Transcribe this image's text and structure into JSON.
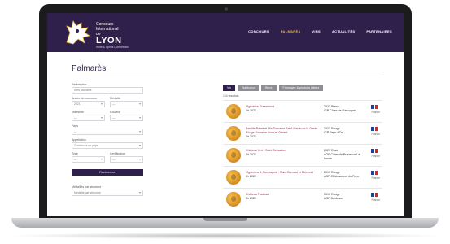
{
  "brand": {
    "line1": "Concours",
    "line2": "International",
    "line3": "de",
    "name": "LYON",
    "tagline": "Wine & Spirits Competition"
  },
  "nav": [
    "CONCOURS",
    "PALMARÈS",
    "VINS",
    "ACTUALITÉS",
    "PARTENAIRES"
  ],
  "page_title": "Palmarès",
  "filters": {
    "search_label": "Rechercher",
    "search_placeholder": "nom, domaine",
    "year_label": "Année du concours",
    "year_value": "2021",
    "medal_label": "Médaille",
    "medal_value": "—",
    "vintage_label": "Millésime",
    "vintage_value": "—",
    "color_label": "Couleur",
    "color_value": "—",
    "country_label": "Pays",
    "country_value": "—",
    "appellation_label": "Appellation",
    "appellation_value": "Choisissez un pays",
    "type_label": "Type",
    "type_value": "—",
    "certif_label": "Certification",
    "certif_value": "—",
    "button": "Rechercher",
    "sort_label": "Médailles par structure",
    "sort_value": "Médaille par structure"
  },
  "tabs": [
    "Vin",
    "Spiritueux",
    "Bière",
    "Fromages & produits laitiers"
  ],
  "result_count": "164 résultats",
  "results": [
    {
      "name": "Vignobles Greenwood",
      "vintage": "Or 2021",
      "medal": "2021 Blanc",
      "appellation": "IGP Côtes de Gascogne",
      "country": "France"
    },
    {
      "name": "Famille Rapet et Fils Domaine Saint-Martin de la Garde Rouge Domaine Anne et Gérard",
      "vintage": "Or 2021",
      "medal": "2021 Rouge",
      "appellation": "IGP Pays d'Oc",
      "country": "France"
    },
    {
      "name": "Château Vert - Saint Sebastien",
      "vintage": "Or 2021",
      "medal": "2021 Rosé",
      "appellation": "AOP Côtes de Provence La Londe",
      "country": "France"
    },
    {
      "name": "Vignerons & Compagnie - Saint Bernard et Belvezet",
      "vintage": "Or 2021",
      "medal": "2019 Rouge",
      "appellation": "AOP Châteauneuf du Pape",
      "country": "France"
    },
    {
      "name": "Château Pradeau",
      "vintage": "Or 2021",
      "medal": "2019 Rouge",
      "appellation": "AOP Bordeaux",
      "country": "France"
    }
  ],
  "colors": {
    "brand": "#2e1f4b",
    "accent": "#e8b931",
    "flag_blue": "#1f3f9a",
    "flag_white": "#ffffff",
    "flag_red": "#d8222f"
  }
}
